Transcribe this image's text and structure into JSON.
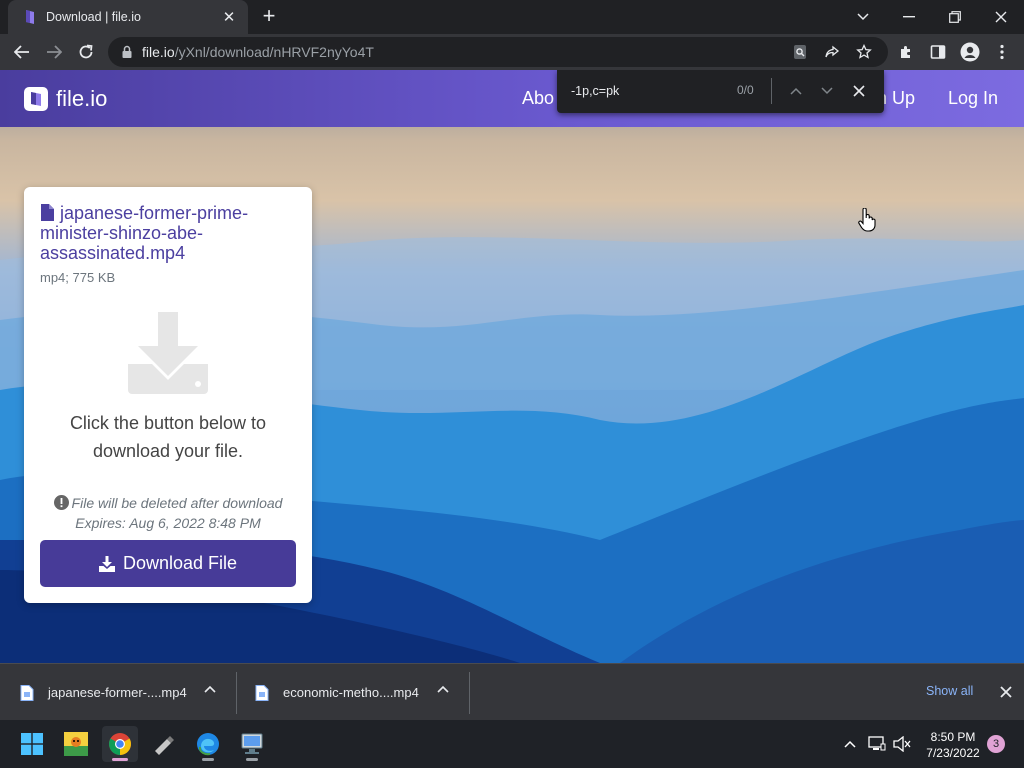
{
  "browser": {
    "tab": {
      "title": "Download | file.io",
      "favicon": "file-io-logo-icon"
    },
    "url_host": "file.io",
    "url_path": "/yXnl/download/nHRVF2nyYo4T",
    "controls": {
      "minimize": "minimize-icon",
      "maximize": "restore-icon",
      "close": "close-icon"
    }
  },
  "find_bar": {
    "query": "-1p,c=pk",
    "count": "0/0"
  },
  "site": {
    "logo_text": "file.io",
    "nav": {
      "about": "Abo",
      "signup": "n Up",
      "login": "Log In"
    }
  },
  "file_card": {
    "file_name": "japanese-former-prime-minister-shinzo-abe-assassinated.mp4",
    "file_meta": "mp4; 775 KB",
    "instructions_line1": "Click the button below to",
    "instructions_line2": "download your file.",
    "warning": "File will be deleted after download",
    "expires": "Expires: Aug 6, 2022 8:48 PM",
    "button_label": "Download File"
  },
  "download_shelf": {
    "items": [
      {
        "label": "japanese-former-....mp4"
      },
      {
        "label": "economic-metho....mp4"
      }
    ],
    "show_all": "Show all"
  },
  "taskbar": {
    "apps": [
      "windows-start-icon",
      "photo-app-icon",
      "chrome-icon",
      "usb-tool-icon",
      "edge-icon",
      "network-app-icon"
    ],
    "time": "8:50 PM",
    "date": "7/23/2022",
    "notifications": "3"
  },
  "colors": {
    "header_gradient_start": "#4a3d9e",
    "header_gradient_end": "#7c6be0",
    "button_purple": "#473b98",
    "file_name_purple": "#4b3fa0",
    "link_blue": "#8ab4f8"
  }
}
